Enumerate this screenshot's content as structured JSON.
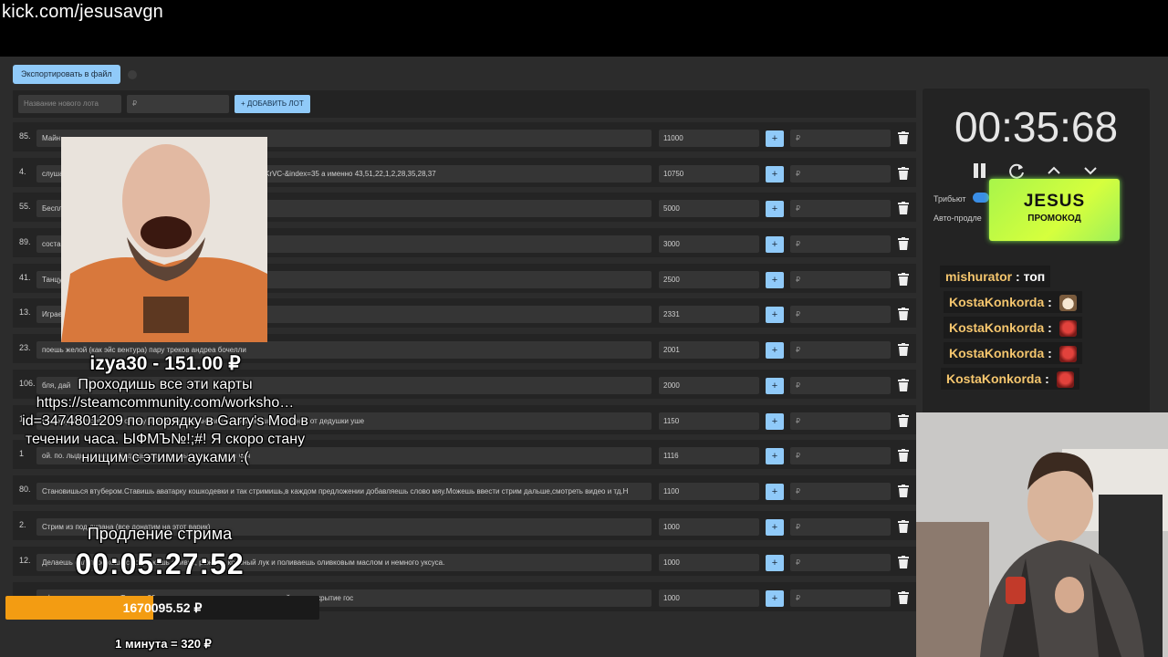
{
  "browser": {
    "url": "kick.com/jesusavgn"
  },
  "toolbar": {
    "export_label": "Экспортировать в файл"
  },
  "add_lot": {
    "name_placeholder": "Название нового лота",
    "price_placeholder": "₽",
    "add_label": "+ ДОБАВИТЬ ЛОТ"
  },
  "lots": [
    {
      "num": "85.",
      "title": "Майн",
      "amount": "11000",
      "plus": "+",
      "rub": "₽"
    },
    {
      "num": "4.",
      "title": "слушае                                   =kcw4VPDG9Lw&list=PL2oDoeHo5WQ0YtkDvypIkKRTisN4KrVC-&index=35 а именно 43,51,22,1,2,28,35,28,37",
      "amount": "10750",
      "plus": "+",
      "rub": "₽"
    },
    {
      "num": "55.",
      "title": "Беспл",
      "amount": "5000",
      "plus": "+",
      "rub": "₽"
    },
    {
      "num": "89.",
      "title": "соста                                   шь вилки",
      "amount": "3000",
      "plus": "+",
      "rub": "₽"
    },
    {
      "num": "41.",
      "title": "Танцу                                   ки крыльшки / какашки мне в кармашки",
      "amount": "2500",
      "plus": "+",
      "rub": "₽"
    },
    {
      "num": "13.",
      "title": "Играе",
      "amount": "2331",
      "plus": "+",
      "rub": "₽"
    },
    {
      "num": "23.",
      "title": "поешь желой (как эйс вентура) пару треков андреа бочелли",
      "amount": "2001",
      "plus": "+",
      "rub": "₽"
    },
    {
      "num": "106.",
      "title": "бля, дай",
      "amount": "2000",
      "plus": "+",
      "rub": "₽"
    },
    {
      "num": "1.",
      "title": "                                                         я по коробу скребен, по сусеку метен, на сметане мешон, на окошке стужен, я от дедушки уше",
      "amount": "1150",
      "plus": "+",
      "rub": "₽"
    },
    {
      "num": "1",
      "title": "                                               ой. по. лыдыдышкам. Лыдыдышкам крыльшкам. ихихихи чач",
      "amount": "1116",
      "plus": "+",
      "rub": "₽"
    },
    {
      "num": "80.",
      "title": "Становишься втубером.Ставишь аватарку кошкодевки и так стримишь,в каждом предложении добавляешь слово мяу.Можешь ввести стрим дальше,смотреть видео и тд.Н",
      "amount": "1100",
      "plus": "+",
      "rub": "₽"
    },
    {
      "num": "2.",
      "title": "Стрим из под дивана (все донатим на этот варик)",
      "amount": "1000",
      "plus": "+",
      "rub": "₽"
    },
    {
      "num": "12.",
      "title": "Делаешь                                         салат, режешь сыр, режешь оливки, режешь красный лук и поливаешь оливковым маслом и немного уксуса.",
      "amount": "1000",
      "plus": "+",
      "rub": "₽"
    },
    {
      "num": "",
      "title": "                                                               официальных данных. Так что 30 минут стоишь на коленях говоря подайте на закрытие гос",
      "amount": "1000",
      "plus": "+",
      "rub": "₽"
    }
  ],
  "timer": {
    "value": "00:35:68",
    "tribute_label": "Трибьют",
    "autoext_label": "Авто-продле"
  },
  "promo": {
    "line1": "JESUS",
    "line2": "ПРОМОКОД"
  },
  "chat": [
    {
      "user": "mishurator",
      "sep": " : ",
      "msg": "топ",
      "emote": ""
    },
    {
      "user": "KostaKonkorda",
      "sep": " : ",
      "msg": "",
      "emote": "cat"
    },
    {
      "user": "KostaKonkorda",
      "sep": " : ",
      "msg": "",
      "emote": "mask"
    },
    {
      "user": "KostaKonkorda",
      "sep": " : ",
      "msg": "",
      "emote": "mask"
    },
    {
      "user": "KostaKonkorda",
      "sep": " : ",
      "msg": "",
      "emote": "mask"
    }
  ],
  "donation": {
    "name_amount": "izya30 - 151.00 ₽",
    "message": "Проходишь все эти карты https://steamcommunity.com/worksho… id=3474801209 по порядку в Garry's Mod в течении часа. ЫФМЪ№!;#! Я скоро стану нищим с этими ауками :("
  },
  "extension": {
    "label": "Продление стрима",
    "timer": "00:05:27:52",
    "total": "1670095.52 ₽",
    "progress_fraction": 0.47,
    "rate": "1 минута = 320 ₽"
  },
  "colors": {
    "accent": "#90caf9",
    "progress": "#f39c12",
    "promo": "#c8ff3d",
    "chat_user": "#f5c66e"
  }
}
